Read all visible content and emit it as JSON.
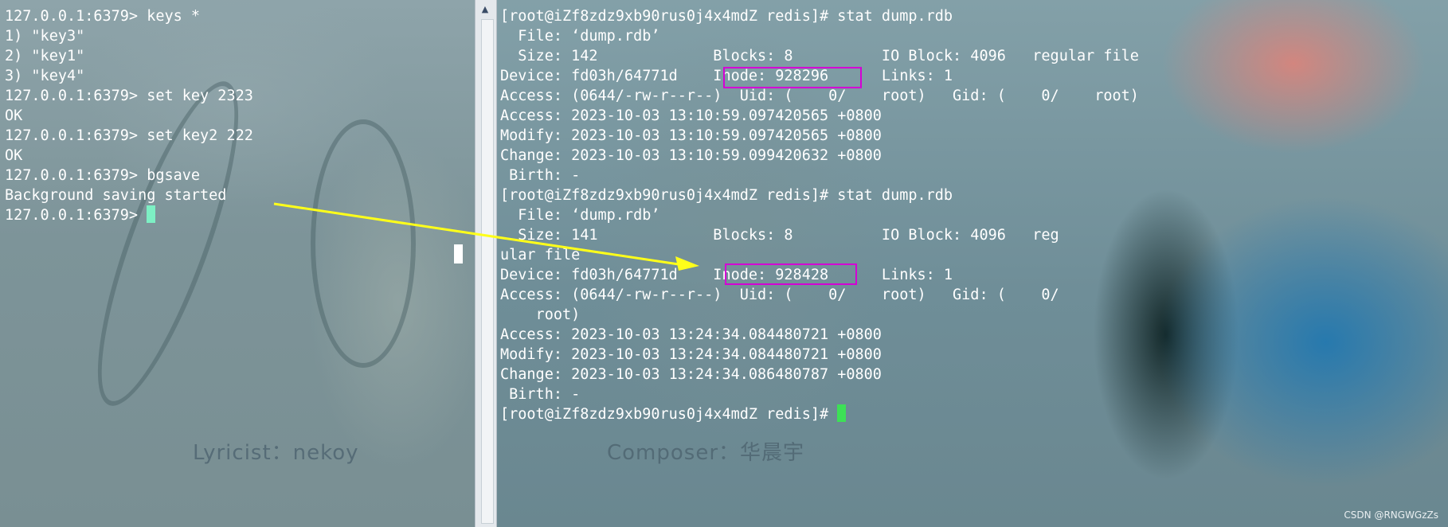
{
  "left_terminal": {
    "lines": [
      "127.0.0.1:6379> keys *",
      "1) \"key3\"",
      "2) \"key1\"",
      "3) \"key4\"",
      "127.0.0.1:6379> set key 2323",
      "OK",
      "127.0.0.1:6379> set key2 222",
      "OK",
      "127.0.0.1:6379> bgsave",
      "Background saving started"
    ],
    "prompt": "127.0.0.1:6379> "
  },
  "right_terminal": {
    "lines": [
      "[root@iZf8zdz9xb90rus0j4x4mdZ redis]# stat dump.rdb",
      "  File: ‘dump.rdb’",
      "  Size: 142             Blocks: 8          IO Block: 4096   regular file",
      "Device: fd03h/64771d    Inode: 928296      Links: 1",
      "Access: (0644/-rw-r--r--)  Uid: (    0/    root)   Gid: (    0/    root)",
      "Access: 2023-10-03 13:10:59.097420565 +0800",
      "Modify: 2023-10-03 13:10:59.097420565 +0800",
      "Change: 2023-10-03 13:10:59.099420632 +0800",
      " Birth: -",
      "[root@iZf8zdz9xb90rus0j4x4mdZ redis]# stat dump.rdb",
      "  File: ‘dump.rdb’",
      "  Size: 141             Blocks: 8          IO Block: 4096   reg",
      "ular file",
      "Device: fd03h/64771d    Inode: 928428      Links: 1",
      "Access: (0644/-rw-r--r--)  Uid: (    0/    root)   Gid: (    0/",
      "    root)",
      "Access: 2023-10-03 13:24:34.084480721 +0800",
      "Modify: 2023-10-03 13:24:34.084480721 +0800",
      "Change: 2023-10-03 13:24:34.086480787 +0800",
      " Birth: -"
    ],
    "prompt": "[root@iZf8zdz9xb90rus0j4x4mdZ redis]# "
  },
  "background_captions": {
    "lyricist": "Lyricist：nekoy",
    "composer": "Composer：华晨宇"
  },
  "watermark": "CSDN @RNGWGzZs",
  "colors": {
    "highlight_box": "#d400d4",
    "arrow": "#ffff1a",
    "left_cursor": "#7df0c4",
    "right_cursor": "#3de056",
    "terminal_text": "#ffffff"
  },
  "icons": {
    "scroll_up": "▲"
  }
}
